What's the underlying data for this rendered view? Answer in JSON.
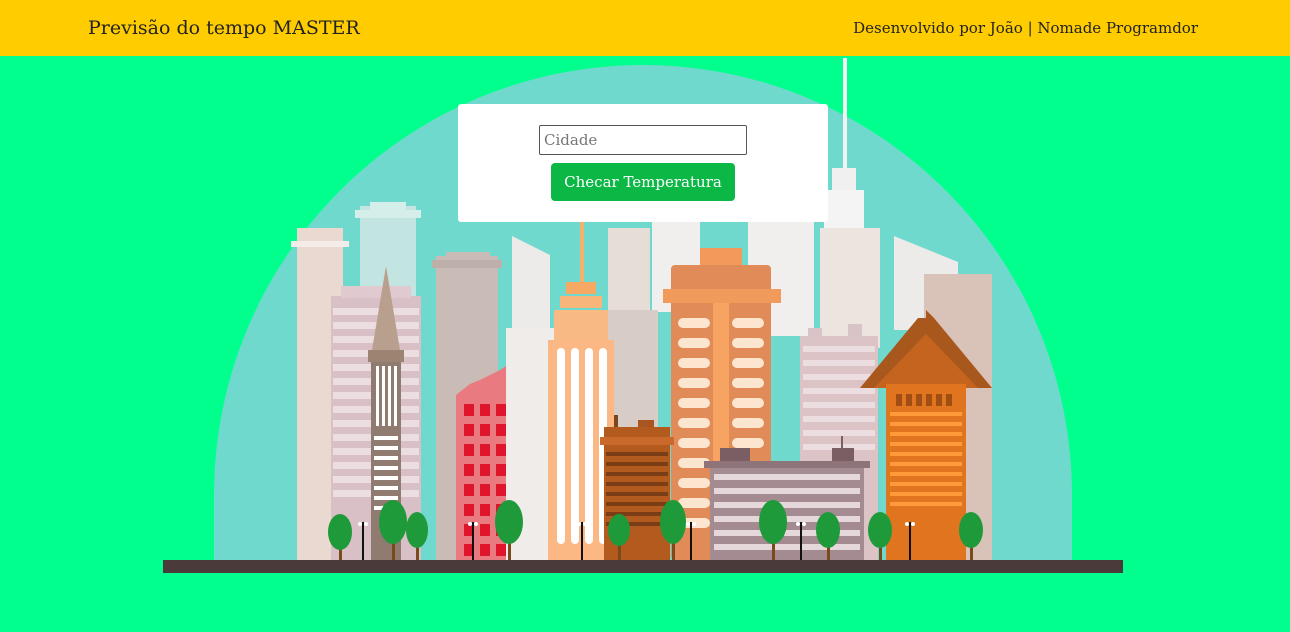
{
  "header": {
    "title": "Previsão do tempo MASTER",
    "credit": "Desenvolvido por João | Nomade Programdor"
  },
  "form": {
    "city_placeholder": "Cidade",
    "city_value": "",
    "submit_label": "Checar Temperatura"
  },
  "colors": {
    "header_bg": "#ffcc00",
    "page_bg": "#00ff8c",
    "dome": "#6fd9ce",
    "button": "#0cb845",
    "ground": "#4a3a3a"
  },
  "illustration": {
    "subject": "city-skyline"
  }
}
